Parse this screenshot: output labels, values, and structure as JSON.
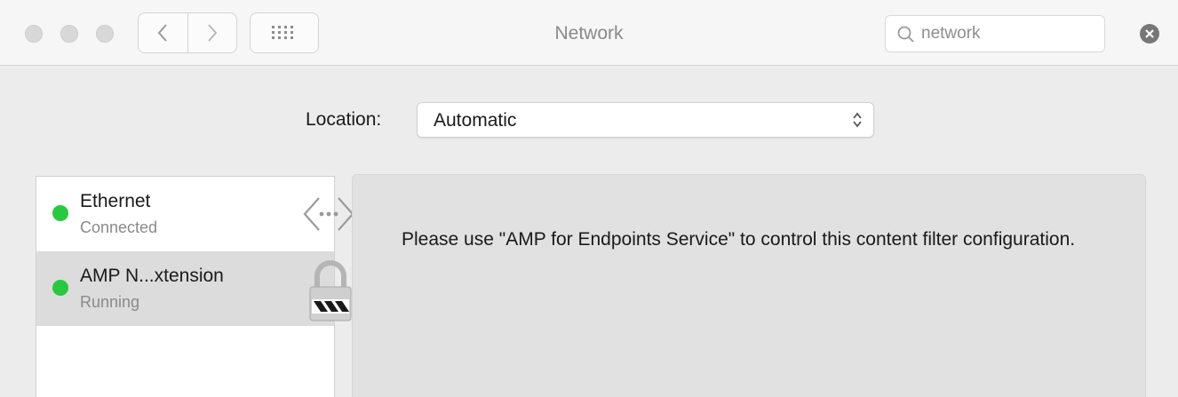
{
  "window": {
    "title": "Network"
  },
  "toolbar": {
    "back_icon": "chevron-left-icon",
    "forward_icon": "chevron-right-icon",
    "show_all_icon": "grid-icon"
  },
  "search": {
    "value": "network",
    "placeholder": "Search",
    "icon": "search-icon",
    "clear_icon": "clear-icon"
  },
  "location": {
    "label": "Location:",
    "value": "Automatic"
  },
  "services": [
    {
      "name": "Ethernet",
      "status": "Connected",
      "status_color": "#28c93f",
      "icon": "ethernet-icon",
      "selected": false
    },
    {
      "name": "AMP N...xtension",
      "status": "Running",
      "status_color": "#28c93f",
      "icon": "lock-icon",
      "selected": true
    }
  ],
  "detail": {
    "message": "Please use \"AMP for Endpoints Service\" to control this content filter configuration."
  },
  "colors": {
    "status_green": "#28c93f",
    "selected_row": "#dcdcdc",
    "pane_background": "#e1e1e1"
  }
}
